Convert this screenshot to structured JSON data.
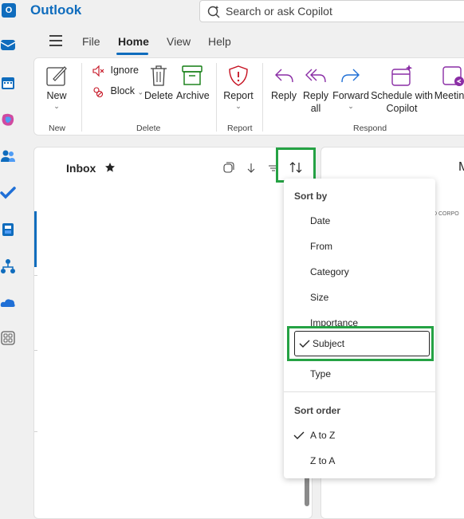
{
  "app": {
    "title": "Outlook",
    "logo": "O"
  },
  "search": {
    "placeholder": "Search or ask Copilot"
  },
  "tabs": [
    {
      "label": "File"
    },
    {
      "label": "Home"
    },
    {
      "label": "View"
    },
    {
      "label": "Help"
    }
  ],
  "ribbon": {
    "new": {
      "label": "New",
      "group": "New"
    },
    "ignore": {
      "label": "Ignore"
    },
    "block": {
      "label": "Block"
    },
    "delete": {
      "label": "Delete",
      "group": "Delete"
    },
    "archive": {
      "label": "Archive"
    },
    "report": {
      "label": "Report",
      "group": "Report"
    },
    "reply": {
      "label": "Reply"
    },
    "reply_all": {
      "line1": "Reply",
      "line2": "all"
    },
    "forward": {
      "label": "Forward"
    },
    "schedule": {
      "line1": "Schedule with",
      "line2": "Copilot"
    },
    "meeting": {
      "label": "Meeting"
    },
    "respond_group": "Respond"
  },
  "list": {
    "folder_title": "Inbox"
  },
  "reading": {
    "initial": "M",
    "corp_text": "D CORPO"
  },
  "sort_menu": {
    "sort_by_header": "Sort by",
    "options": [
      {
        "label": "Date"
      },
      {
        "label": "From"
      },
      {
        "label": "Category"
      },
      {
        "label": "Size"
      },
      {
        "label": "Importance"
      },
      {
        "label": "Subject",
        "selected": true
      },
      {
        "label": "Type"
      }
    ],
    "sort_order_header": "Sort order",
    "order_options": [
      {
        "label": "A to Z",
        "selected": true
      },
      {
        "label": "Z to A"
      }
    ]
  },
  "colors": {
    "accent": "#0f6cbd",
    "highlight_box": "#25a244",
    "report_red": "#c50f1f",
    "archive_green": "#107c10",
    "copilot_purple": "#8a2da5"
  }
}
